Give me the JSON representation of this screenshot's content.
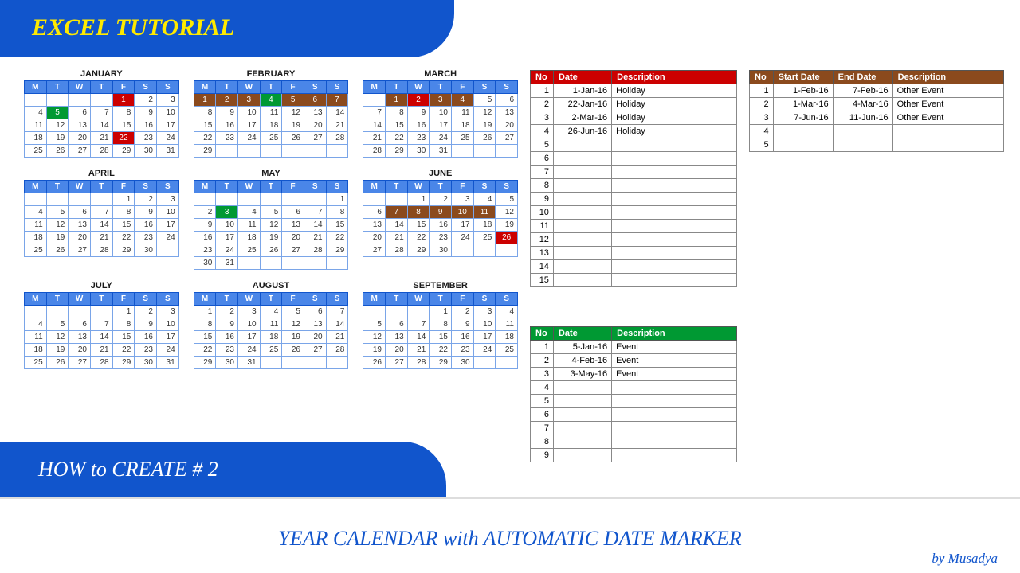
{
  "banner": {
    "title": "EXCEL TUTORIAL",
    "subtitle": "HOW to CREATE # 2"
  },
  "footer": {
    "title": "YEAR CALENDAR with AUTOMATIC DATE MARKER",
    "author": "by Musadya"
  },
  "day_headers": [
    "M",
    "T",
    "W",
    "T",
    "F",
    "S",
    "S"
  ],
  "months": [
    {
      "name": "JANUARY",
      "offset": 4,
      "days": 31,
      "marks": {
        "1": "red",
        "5": "green",
        "22": "red"
      }
    },
    {
      "name": "FEBRUARY",
      "offset": 0,
      "days": 29,
      "marks": {
        "1": "brown",
        "2": "brown",
        "3": "brown",
        "4": "green",
        "5": "brown",
        "6": "brown",
        "7": "brown"
      }
    },
    {
      "name": "MARCH",
      "offset": 1,
      "days": 31,
      "marks": {
        "1": "brown",
        "2": "red",
        "3": "brown",
        "4": "brown"
      }
    },
    {
      "name": "APRIL",
      "offset": 4,
      "days": 30,
      "marks": {}
    },
    {
      "name": "MAY",
      "offset": 6,
      "days": 31,
      "marks": {
        "3": "green"
      }
    },
    {
      "name": "JUNE",
      "offset": 2,
      "days": 30,
      "marks": {
        "7": "brown",
        "8": "brown",
        "9": "brown",
        "10": "brown",
        "11": "brown",
        "26": "red"
      }
    },
    {
      "name": "JULY",
      "offset": 4,
      "days": 31,
      "marks": {}
    },
    {
      "name": "AUGUST",
      "offset": 0,
      "days": 31,
      "marks": {}
    },
    {
      "name": "SEPTEMBER",
      "offset": 3,
      "days": 30,
      "marks": {}
    }
  ],
  "table_holiday": {
    "headers": [
      "No",
      "Date",
      "Description"
    ],
    "rows": [
      [
        "1",
        "1-Jan-16",
        "Holiday"
      ],
      [
        "2",
        "22-Jan-16",
        "Holiday"
      ],
      [
        "3",
        "2-Mar-16",
        "Holiday"
      ],
      [
        "4",
        "26-Jun-16",
        "Holiday"
      ],
      [
        "5",
        "",
        ""
      ],
      [
        "6",
        "",
        ""
      ],
      [
        "7",
        "",
        ""
      ],
      [
        "8",
        "",
        ""
      ],
      [
        "9",
        "",
        ""
      ],
      [
        "10",
        "",
        ""
      ],
      [
        "11",
        "",
        ""
      ],
      [
        "12",
        "",
        ""
      ],
      [
        "13",
        "",
        ""
      ],
      [
        "14",
        "",
        ""
      ],
      [
        "15",
        "",
        ""
      ]
    ]
  },
  "table_event": {
    "headers": [
      "No",
      "Date",
      "Description"
    ],
    "rows": [
      [
        "1",
        "5-Jan-16",
        "Event"
      ],
      [
        "2",
        "4-Feb-16",
        "Event"
      ],
      [
        "3",
        "3-May-16",
        "Event"
      ],
      [
        "4",
        "",
        ""
      ],
      [
        "5",
        "",
        ""
      ],
      [
        "6",
        "",
        ""
      ],
      [
        "7",
        "",
        ""
      ],
      [
        "8",
        "",
        ""
      ],
      [
        "9",
        "",
        ""
      ]
    ]
  },
  "table_range": {
    "headers": [
      "No",
      "Start Date",
      "End Date",
      "Description"
    ],
    "rows": [
      [
        "1",
        "1-Feb-16",
        "7-Feb-16",
        "Other Event"
      ],
      [
        "2",
        "1-Mar-16",
        "4-Mar-16",
        "Other Event"
      ],
      [
        "3",
        "7-Jun-16",
        "11-Jun-16",
        "Other Event"
      ],
      [
        "4",
        "",
        "",
        ""
      ],
      [
        "5",
        "",
        "",
        ""
      ]
    ]
  }
}
